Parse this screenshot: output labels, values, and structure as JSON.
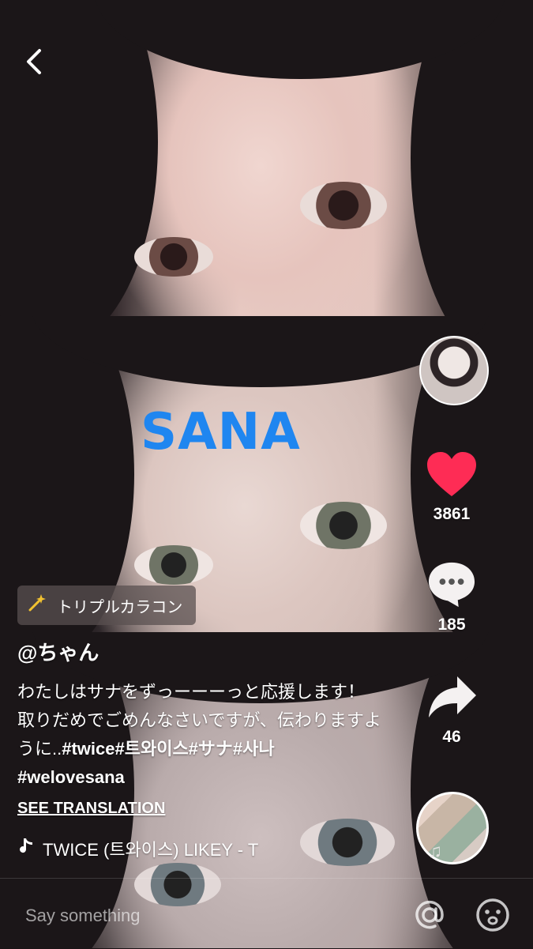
{
  "overlay": {
    "title_text": "SANA",
    "effect_label": "トリプルカラコン"
  },
  "stats": {
    "likes": "3861",
    "comments": "185",
    "shares": "46"
  },
  "post": {
    "username": "@ちゃん",
    "caption_line1": "わたしはサナをずっーーーっと応援します！",
    "caption_line2": "取りだめでごめんなさいですが、伝わりますよ",
    "caption_line3_prefix": "うに..",
    "hashtags_line3": "#twice#트와이스#サナ#사나",
    "hashtag_line4": "#welovesana",
    "see_translation": "SEE TRANSLATION",
    "music": "TWICE (트와이스)    LIKEY - T"
  },
  "comment_bar": {
    "placeholder": "Say something"
  },
  "colors": {
    "heart": "#fe2c55",
    "sana_text": "#1f86f0"
  },
  "icons": [
    "back-chevron-icon",
    "heart-icon",
    "comment-bubble-icon",
    "share-arrow-icon",
    "music-note-icon",
    "at-icon",
    "smile-icon",
    "magic-wand-icon"
  ]
}
